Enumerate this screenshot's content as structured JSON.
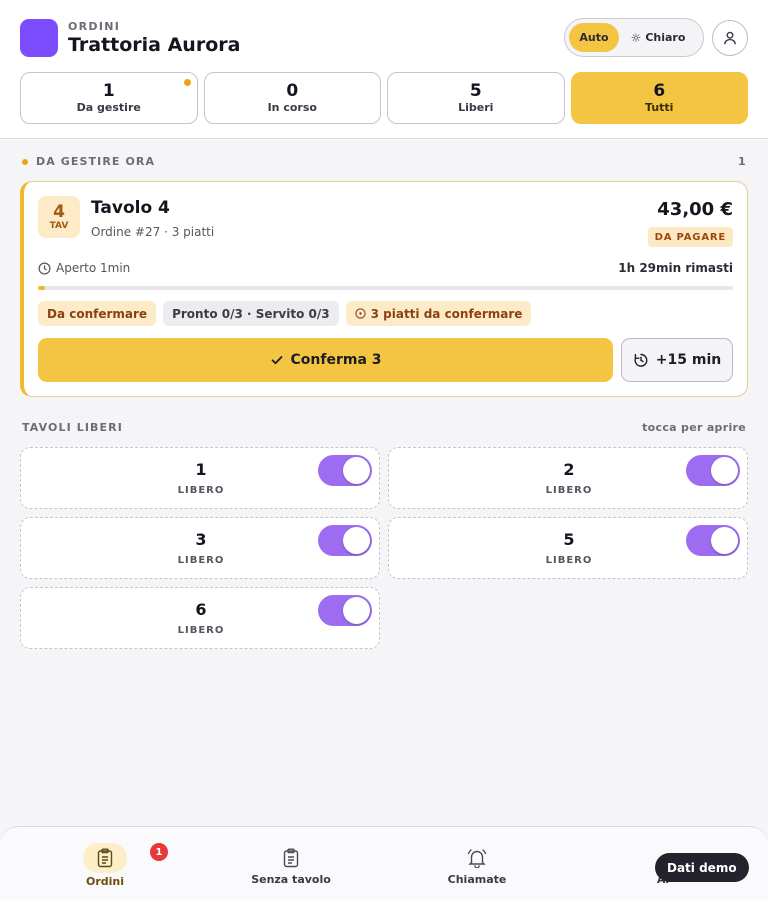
{
  "header": {
    "eyebrow": "ORDINI",
    "title": "Trattoria Aurora",
    "brand_color": "#7c4dff",
    "theme": {
      "auto_label": "Auto",
      "light_label": "Chiaro",
      "selected": "Auto"
    },
    "account_icon": "user-icon"
  },
  "filters": [
    {
      "count": "1",
      "label": "Da gestire",
      "has_dot": true
    },
    {
      "count": "0",
      "label": "In corso"
    },
    {
      "count": "5",
      "label": "Liberi"
    },
    {
      "count": "6",
      "label": "Tutti",
      "active": true
    }
  ],
  "pending_section": {
    "title": "DA GESTIRE ORA",
    "count": "1"
  },
  "order": {
    "table_number": "4",
    "table_abbr": "TAV",
    "title": "Tavolo 4",
    "subtitle": "Ordine #27 · 3 piatti",
    "price": "43,00 €",
    "payment_status": "DA PAGARE",
    "opened": "Aperto 1min",
    "remaining": "1h 29min rimasti",
    "elapsed_fraction": 0.01,
    "chips": [
      {
        "label": "Da confermare",
        "style": "warn"
      },
      {
        "label": "Pronto 0/3 · Servito 0/3",
        "style": "neutral"
      },
      {
        "label": "3 piatti da confermare",
        "style": "warn",
        "icon": "alert-circle-icon"
      }
    ],
    "confirm_label": "Conferma 3",
    "extend_label": "+15 min"
  },
  "free_section": {
    "title": "TAVOLI LIBERI",
    "hint": "tocca per aprire"
  },
  "free_tables": [
    {
      "number": "1",
      "status": "LIBERO",
      "enabled": true
    },
    {
      "number": "2",
      "status": "LIBERO",
      "enabled": true
    },
    {
      "number": "3",
      "status": "LIBERO",
      "enabled": true
    },
    {
      "number": "5",
      "status": "LIBERO",
      "enabled": true
    },
    {
      "number": "6",
      "status": "LIBERO",
      "enabled": true
    }
  ],
  "bottom_nav": {
    "items": [
      {
        "label": "Ordini",
        "icon": "clipboard-icon",
        "active": true,
        "badge": "1"
      },
      {
        "label": "Senza tavolo",
        "icon": "clipboard-icon"
      },
      {
        "label": "Chiamate",
        "icon": "bell-icon"
      },
      {
        "label": "Al",
        "icon": "partially-hidden-icon"
      }
    ]
  },
  "demo_label": "Dati demo",
  "colors": {
    "accent": "#f4c542",
    "toggle": "#9d6cf0",
    "warning": "#e8a317",
    "badge": "#e5383b"
  }
}
